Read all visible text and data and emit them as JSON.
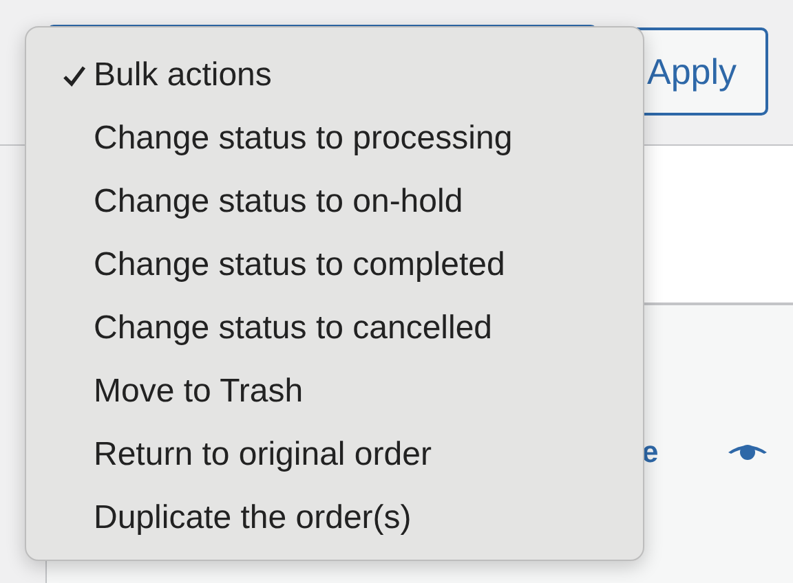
{
  "toolbar": {
    "apply_button": "Apply"
  },
  "row": {
    "cut_text": "e"
  },
  "menu": {
    "items": [
      {
        "label": "Bulk actions",
        "selected": true
      },
      {
        "label": "Change status to processing",
        "selected": false
      },
      {
        "label": "Change status to on-hold",
        "selected": false
      },
      {
        "label": "Change status to completed",
        "selected": false
      },
      {
        "label": "Change status to cancelled",
        "selected": false
      },
      {
        "label": "Move to Trash",
        "selected": false
      },
      {
        "label": "Return to original order",
        "selected": false
      },
      {
        "label": "Duplicate the order(s)",
        "selected": false
      }
    ]
  }
}
